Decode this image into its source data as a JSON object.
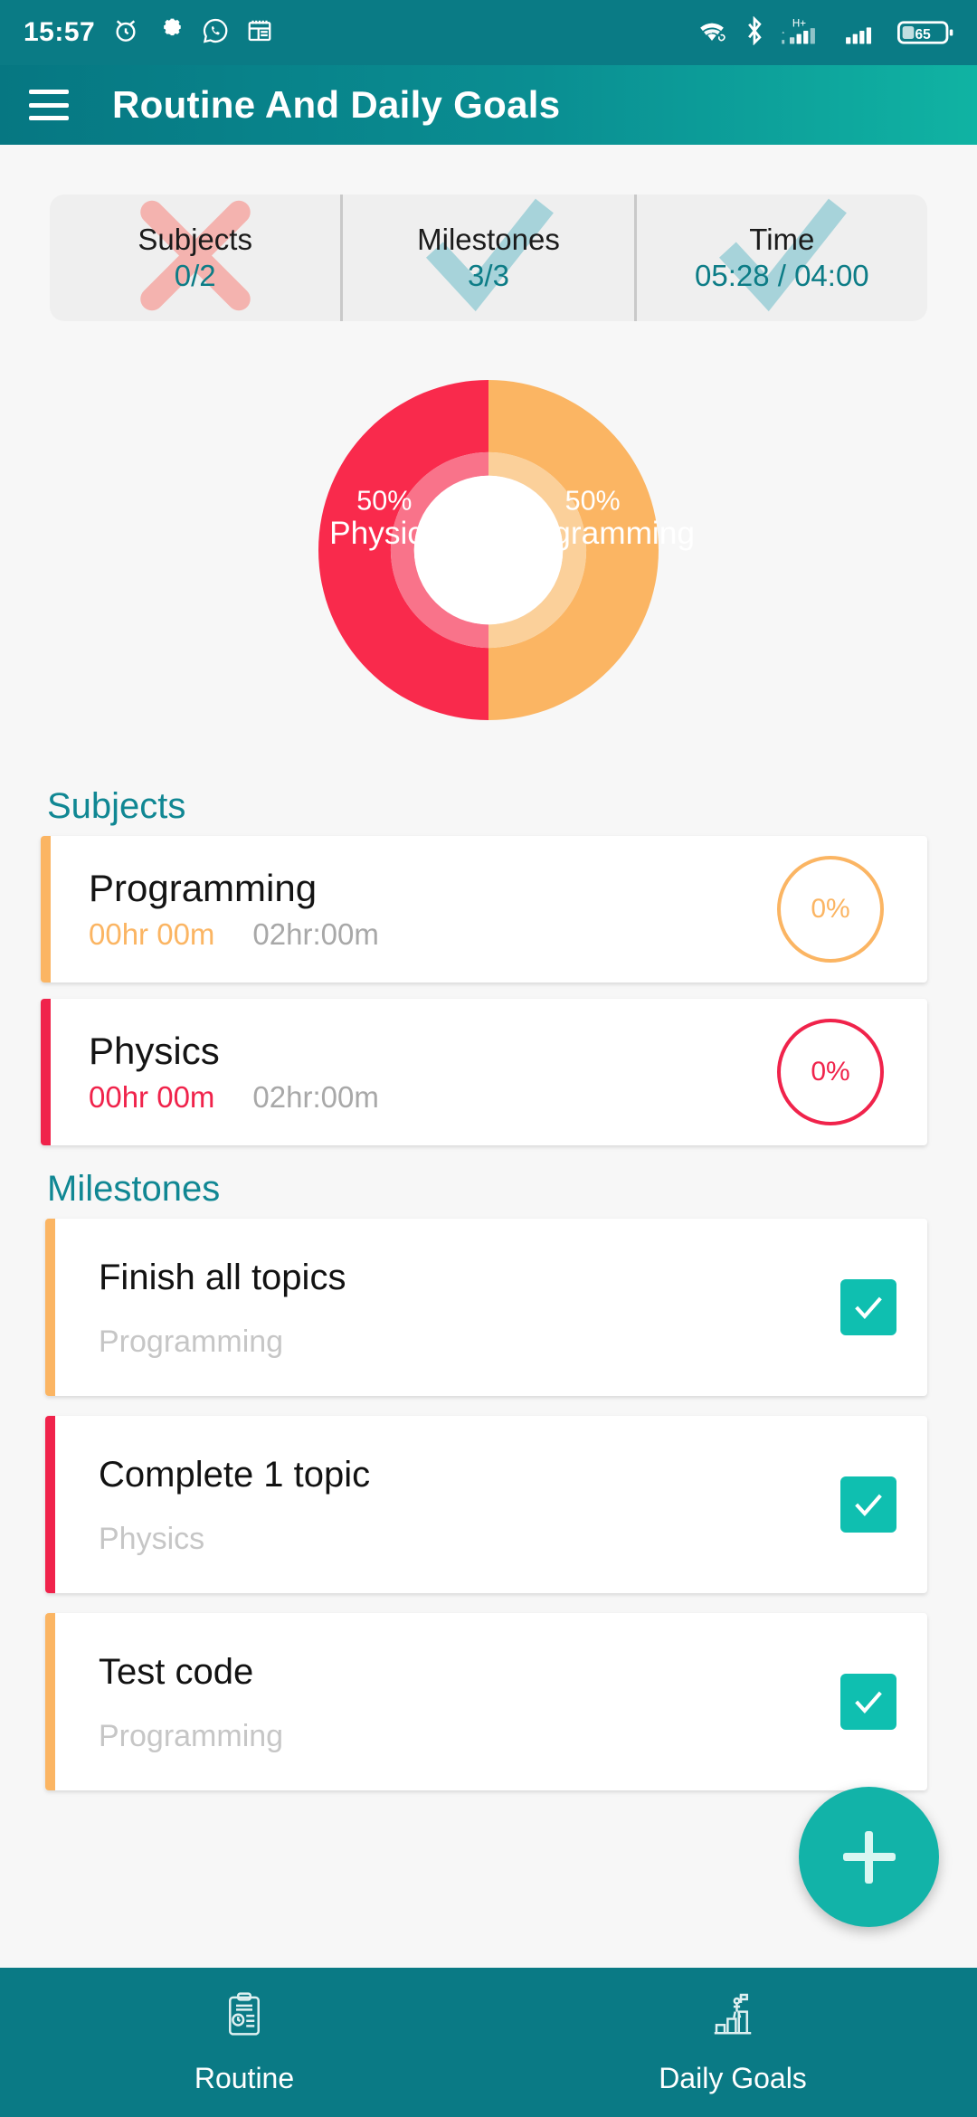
{
  "status_bar": {
    "time": "15:57",
    "left_icons": [
      "alarm-clock-icon",
      "gear-icon",
      "whatsapp-icon",
      "calendar-note-icon"
    ],
    "right_icons": [
      "wifi-icon",
      "bluetooth-icon",
      "signal-hplus-icon",
      "signal-icon"
    ],
    "network_type": "H+",
    "battery_level": "65"
  },
  "app_bar": {
    "title": "Routine And Daily Goals",
    "menu_icon": "hamburger-icon"
  },
  "stats": [
    {
      "label": "Subjects",
      "value": "0/2",
      "mark": "cross",
      "mark_color": "#F4B3AF"
    },
    {
      "label": "Milestones",
      "value": "3/3",
      "mark": "check",
      "mark_color": "#A7D3DA"
    },
    {
      "label": "Time",
      "value": "05:28 / 04:00",
      "mark": "check",
      "mark_color": "#A7D3DA"
    }
  ],
  "chart_data": {
    "type": "pie",
    "title": "",
    "donut": true,
    "labels": [
      "Physics",
      "Programming"
    ],
    "values": [
      50,
      50
    ],
    "value_labels": [
      "50%",
      "50%"
    ],
    "colors": [
      "#F92A4C",
      "#FBB563"
    ],
    "inner_ring_colors": [
      "#F9738A",
      "#FBD09A"
    ],
    "legend": "inside-slices"
  },
  "subjects_section": {
    "heading": "Subjects",
    "items": [
      {
        "name": "Programming",
        "time_done": "00hr 00m",
        "time_total": "02hr:00m",
        "percent": "0%",
        "color": "#FBB563"
      },
      {
        "name": "Physics",
        "time_done": "00hr 00m",
        "time_total": "02hr:00m",
        "percent": "0%",
        "color": "#F0234B"
      }
    ]
  },
  "milestones_section": {
    "heading": "Milestones",
    "items": [
      {
        "title": "Finish all topics",
        "subject": "Programming",
        "checked": true,
        "color": "#FBB563"
      },
      {
        "title": "Complete 1 topic",
        "subject": "Physics",
        "checked": true,
        "color": "#F0234B"
      },
      {
        "title": "Test code",
        "subject": "Programming",
        "checked": true,
        "color": "#FBB563"
      }
    ]
  },
  "fab": {
    "icon": "plus-icon",
    "label": "Add"
  },
  "bottom_nav": {
    "items": [
      {
        "label": "Routine",
        "icon": "clipboard-checklist-icon"
      },
      {
        "label": "Daily Goals",
        "icon": "podium-flag-icon"
      }
    ]
  },
  "theme": {
    "primary": "#0A7A85",
    "accent": "#12B3A8",
    "orange": "#FBB563",
    "crimson": "#F0234B",
    "background": "#F7F7F7"
  }
}
